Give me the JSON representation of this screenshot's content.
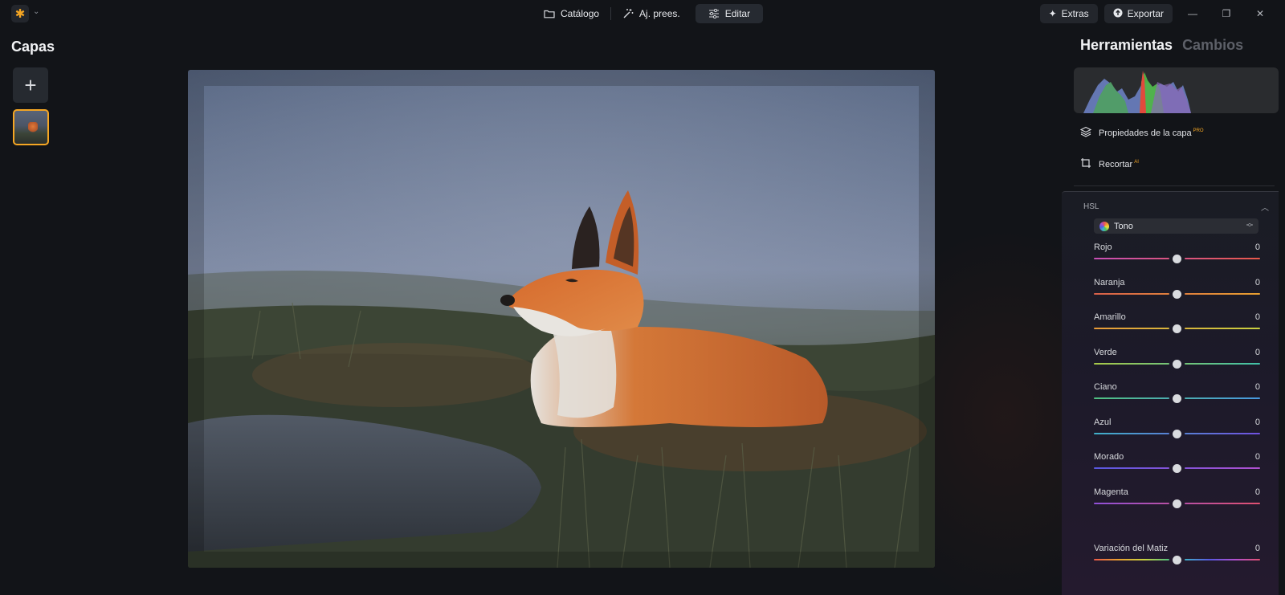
{
  "topbar": {
    "nav": [
      {
        "label": "Catálogo",
        "icon": "folder-icon"
      },
      {
        "label": "Aj. prees.",
        "icon": "magic-wand-icon"
      },
      {
        "label": "Editar",
        "icon": "sliders-icon",
        "active": true
      }
    ],
    "extras_label": "Extras",
    "export_label": "Exportar"
  },
  "layers": {
    "title": "Capas"
  },
  "tools": {
    "tab_active": "Herramientas",
    "tab_inactive": "Cambios",
    "layer_properties": "Propiedades de la capa",
    "layer_properties_badge": "PRO",
    "crop": "Recortar",
    "crop_badge": "AI"
  },
  "hsl": {
    "header": "HSL",
    "mode": "Tono",
    "sliders": [
      {
        "label": "Rojo",
        "value": "0",
        "left": "#c84fb6",
        "right": "#e8584a"
      },
      {
        "label": "Naranja",
        "value": "0",
        "left": "#d8604a",
        "right": "#e8a030"
      },
      {
        "label": "Amarillo",
        "value": "0",
        "left": "#e89a38",
        "right": "#c8d040"
      },
      {
        "label": "Verde",
        "value": "0",
        "left": "#a8c848",
        "right": "#40c0a8"
      },
      {
        "label": "Ciano",
        "value": "0",
        "left": "#50c080",
        "right": "#4898e0"
      },
      {
        "label": "Azul",
        "value": "0",
        "left": "#40b0c8",
        "right": "#7050e0"
      },
      {
        "label": "Morado",
        "value": "0",
        "left": "#5858e0",
        "right": "#b050d0"
      },
      {
        "label": "Magenta",
        "value": "0",
        "left": "#9050d8",
        "right": "#e05070"
      }
    ],
    "hue_shift": {
      "label": "Variación del Matiz",
      "value": "0"
    }
  }
}
